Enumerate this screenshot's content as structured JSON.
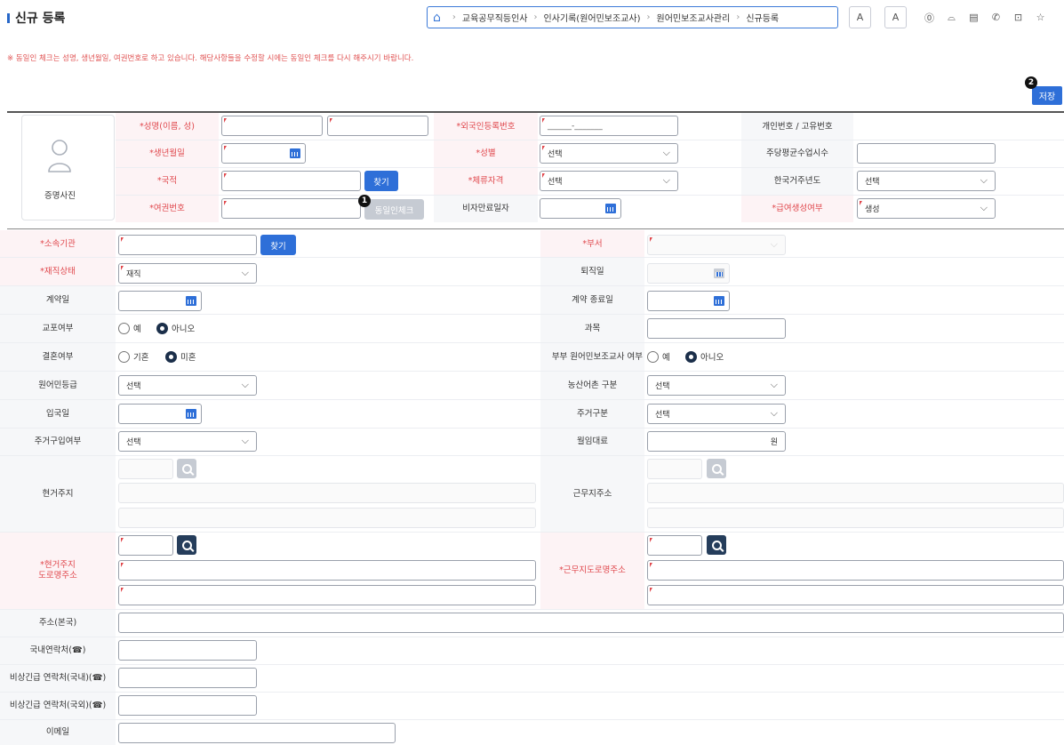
{
  "page": {
    "title": "신규 등록"
  },
  "breadcrumb": [
    "교육공무직등인사",
    "인사기록(원어민보조교사)",
    "원어민보조교사관리",
    "신규등록"
  ],
  "toolbar": {
    "font_small": "A",
    "font_large": "A"
  },
  "notice": "※ 동일인 체크는 성명, 생년월일, 여권번호로 하고 있습니다. 해당사항들을 수정할 시에는 동일인 체크를 다시 해주시기 바랍니다.",
  "badges": {
    "one": "1",
    "two": "2"
  },
  "save_label": "저장",
  "top": {
    "name_label": "*성명(이름, 성)",
    "alien_label": "*외국인등록번호",
    "alien_placeholder": "______-_______",
    "personal_id_label": "개인번호 / 고유번호",
    "birth_label": "*생년월일",
    "gender_label": "*성별",
    "gender_value": "선택",
    "weekly_hours_label": "주당평균수업시수",
    "nation_label": "*국적",
    "find_label": "찾기",
    "visa_label": "*체류자격",
    "visa_value": "선택",
    "korea_years_label": "한국거주년도",
    "korea_years_value": "선택",
    "passport_label": "*여권번호",
    "dup_check_label": "동일인체크",
    "visa_expire_label": "비자만료일자",
    "salary_label": "*급여생성여부",
    "salary_value": "생성",
    "photo_label": "증명사진"
  },
  "main": {
    "org_label": "*소속기관",
    "find_label": "찾기",
    "dept_label": "*부서",
    "status_label": "*재직상태",
    "status_value": "재직",
    "retire_label": "퇴직일",
    "contract_label": "계약일",
    "contract_end_label": "계약 종료일",
    "kyopo_label": "교포여부",
    "yes": "예",
    "no": "아니오",
    "subject_label": "과목",
    "marriage_label": "결혼여부",
    "married": "기혼",
    "single": "미혼",
    "spouse_label": "부부 원어민보조교사 여부",
    "grade_label": "원어민등급",
    "grade_value": "선택",
    "rural_label": "농산어촌 구분",
    "rural_value": "선택",
    "entry_label": "입국일",
    "housing_type_label": "주거구분",
    "housing_type_value": "선택",
    "housing_buy_label": "주거구입여부",
    "housing_buy_value": "선택",
    "rent_label": "월임대료",
    "rent_unit": "원",
    "current_addr_label": "현거주지",
    "work_addr_label": "근무지주소",
    "current_road_label_1": "*현거주지",
    "current_road_label_2": "도로명주소",
    "work_road_label": "*근무지도로명주소",
    "home_addr_label": "주소(본국)",
    "domestic_phone_label": "국내연락처(☎)",
    "emergency_domestic_label": "비상긴급 연락처(국내)(☎)",
    "emergency_overseas_label": "비상긴급 연락처(국외)(☎)",
    "email_label": "이메일"
  },
  "colors": {
    "accent": "#2e6fd8",
    "required": "#e0474c",
    "dark_button": "#253d5b"
  }
}
